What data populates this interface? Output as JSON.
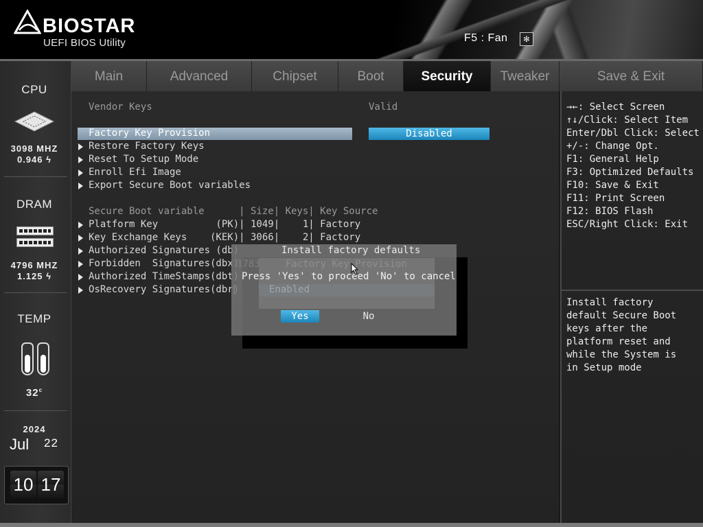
{
  "header": {
    "logo": "BIOSTAR",
    "subtitle": "UEFI BIOS Utility",
    "fan_hint": "F5 : Fan"
  },
  "sidebar": {
    "cpu_label": "CPU",
    "cpu_freq": "3098 MHZ",
    "cpu_volt": "0.946",
    "dram_label": "DRAM",
    "dram_freq": "4796 MHZ",
    "dram_volt": "1.125",
    "temp_label": "TEMP",
    "temp_value": "32",
    "temp_unit": "c",
    "year": "2024",
    "month": "Jul",
    "day": "22",
    "clock_hour": "10",
    "clock_min": "17"
  },
  "tabs": [
    "Main",
    "Advanced",
    "Chipset",
    "Boot",
    "Security",
    "Tweaker",
    "Save & Exit"
  ],
  "active_tab": "Security",
  "main": {
    "vendor_keys_label": "Vendor Keys",
    "vendor_keys_value": "Valid",
    "factory_key_label": "Factory Key Provision",
    "factory_key_value": "Disabled",
    "menu_items": [
      "Restore Factory Keys",
      "Reset To Setup Mode",
      "Enroll Efi Image",
      "Export Secure Boot variables"
    ],
    "table_header": "Secure Boot variable      | Size| Keys| Key Source",
    "table_rows": [
      "Platform Key          (PK)| 1049|    1| Factory",
      "Key Exchange Keys    (KEK)| 3066|    2| Factory",
      "Authorized Signatures (db)",
      "Forbidden  Signatures(dbx)",
      "Authorized TimeStamps(dbt)",
      "OsRecovery Signatures(dbr)"
    ],
    "pipe": "|",
    "ghost_number": "1783"
  },
  "dialog": {
    "title": "Install factory defaults",
    "message": "Press 'Yes' to proceed 'No' to cancel",
    "yes_label": "Yes",
    "no_label": "No",
    "ghost_title": "Factory Key Provision",
    "ghost_option": "Enabled"
  },
  "help_keys": [
    "→←: Select Screen",
    "↑↓/Click: Select Item",
    "Enter/Dbl Click: Select",
    "+/-: Change Opt.",
    "F1: General Help",
    "F3: Optimized Defaults",
    "F10: Save & Exit",
    "F11: Print Screen",
    "F12: BIOS Flash",
    "ESC/Right Click: Exit"
  ],
  "help_description": [
    "Install factory",
    "default Secure Boot",
    "keys after the",
    "platform reset and",
    "while the System is",
    "in Setup mode"
  ],
  "icons": {
    "fan": "fan-icon",
    "volt": "lightning-icon",
    "cpu": "cpu-chip-icon",
    "dram": "dram-module-icon",
    "temp": "thermometer-icon",
    "cursor": "mouse-pointer-icon"
  },
  "colors": {
    "accent": "#2a9fd6",
    "highlight": "#8fa3b6",
    "background": "#262626"
  }
}
